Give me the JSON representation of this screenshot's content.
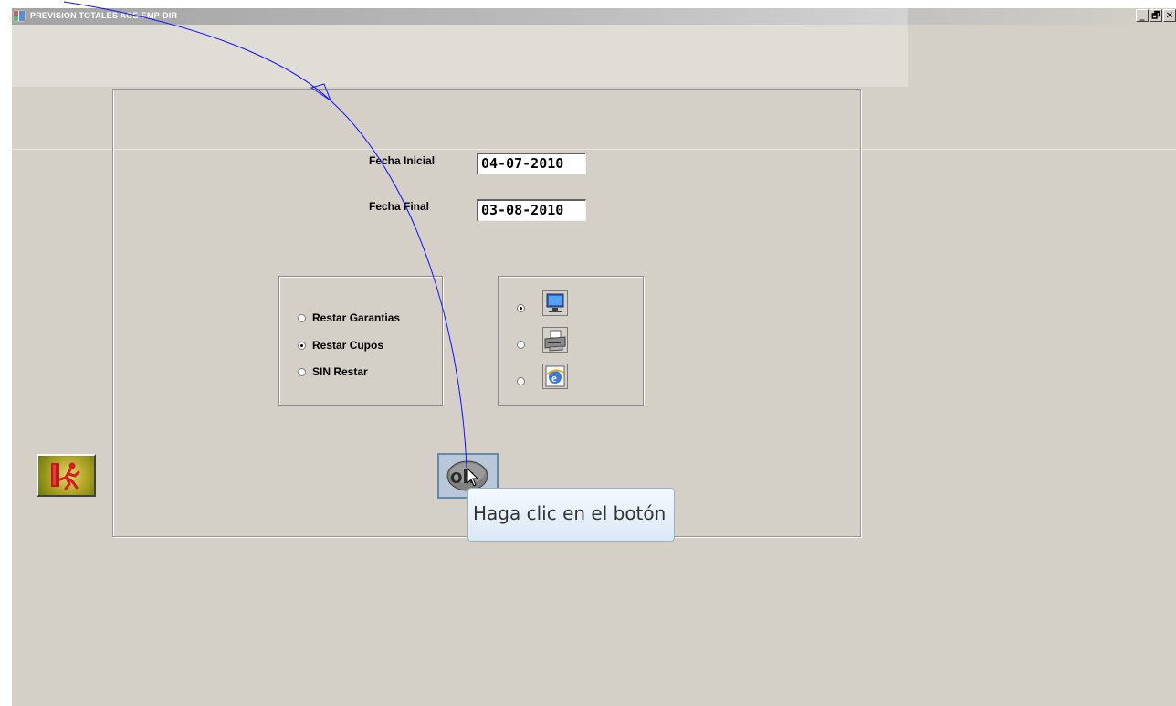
{
  "window": {
    "title": "PREVISION TOTALES AGE-EMP-DIR",
    "controls": {
      "minimize": "_",
      "restore": "🗗",
      "close": "✕"
    }
  },
  "form": {
    "fecha_inicial": {
      "label": "Fecha Inicial",
      "value": "04-07-2010"
    },
    "fecha_final": {
      "label": "Fecha Final",
      "value": "03-08-2010"
    }
  },
  "restar_options": [
    {
      "label": "Restar Garantias",
      "selected": false
    },
    {
      "label": "Restar Cupos",
      "selected": true
    },
    {
      "label": "SIN Restar",
      "selected": false
    }
  ],
  "output_options": [
    {
      "icon": "monitor-icon",
      "selected": true
    },
    {
      "icon": "printer-icon",
      "selected": false
    },
    {
      "icon": "internet-explorer-icon",
      "selected": false
    }
  ],
  "buttons": {
    "ok": "ok",
    "exit_icon": "exit-door-icon"
  },
  "tooltip": {
    "text": "Haga clic en el botón"
  },
  "annotation_color": "#1010ff"
}
